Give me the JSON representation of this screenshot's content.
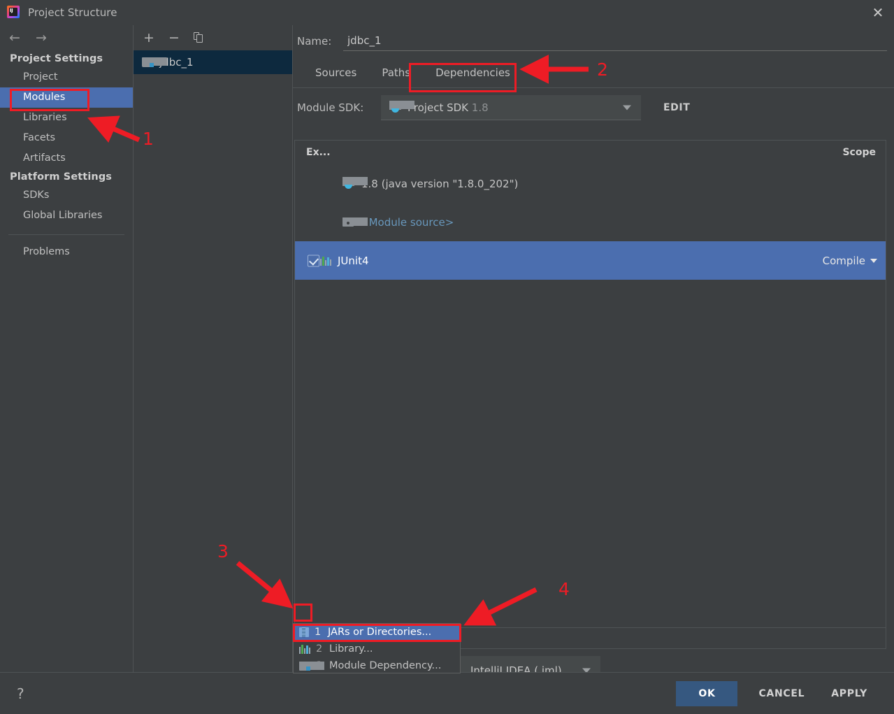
{
  "window": {
    "title": "Project Structure",
    "logo_icon": "intellij-idea-logo",
    "close_icon": "close-icon"
  },
  "sidebar": {
    "nav": {
      "back_icon": "arrow-left-icon",
      "forward_icon": "arrow-right-icon"
    },
    "groups": [
      {
        "title": "Project Settings",
        "items": [
          {
            "label": "Project",
            "selected": false
          },
          {
            "label": "Modules",
            "selected": true
          },
          {
            "label": "Libraries",
            "selected": false
          },
          {
            "label": "Facets",
            "selected": false
          },
          {
            "label": "Artifacts",
            "selected": false
          }
        ]
      },
      {
        "title": "Platform Settings",
        "items": [
          {
            "label": "SDKs",
            "selected": false
          },
          {
            "label": "Global Libraries",
            "selected": false
          }
        ]
      }
    ],
    "problems_label": "Problems"
  },
  "module_panel": {
    "toolbar": {
      "add_label": "+",
      "remove_label": "−",
      "copy_icon": "copy-icon"
    },
    "modules": [
      {
        "label": "jdbc_1",
        "icon": "module-folder-icon",
        "selected": true
      }
    ]
  },
  "main": {
    "name_label": "Name:",
    "name_value": "jdbc_1",
    "tabs": [
      {
        "label": "Sources",
        "active": false
      },
      {
        "label": "Paths",
        "active": false
      },
      {
        "label": "Dependencies",
        "active": true
      }
    ],
    "module_sdk_label": "Module SDK:",
    "module_sdk_value": "Project SDK",
    "module_sdk_version": "1.8",
    "module_sdk_icon": "java-sdk-icon",
    "edit_label": "EDIT",
    "dependencies": {
      "columns": [
        "Ex...",
        "Scope"
      ],
      "rows": [
        {
          "name": "1.8 (java version \"1.8.0_202\")",
          "icon": "java-sdk-icon",
          "scope": "",
          "checked": false,
          "selected": false,
          "link": false
        },
        {
          "name": "<Module source>",
          "icon": "module-source-icon",
          "scope": "",
          "checked": false,
          "selected": false,
          "link": true
        },
        {
          "name": "JUnit4",
          "icon": "library-icon",
          "scope": "Compile",
          "checked": true,
          "selected": true,
          "link": false
        }
      ]
    },
    "dep_toolbar": {
      "add_label": "+",
      "remove_label": "−",
      "move_up_icon": "arrow-up-icon",
      "move_down_icon": "arrow-down-icon",
      "edit_icon": "pencil-icon"
    },
    "iml_combo_value": "IntelliJ IDEA (.iml)"
  },
  "add_menu": {
    "items": [
      {
        "number": "1",
        "label": "JARs or Directories...",
        "icon": "jar-icon",
        "selected": true
      },
      {
        "number": "2",
        "label": "Library...",
        "icon": "library-icon",
        "selected": false
      },
      {
        "number": "3",
        "label": "Module Dependency...",
        "icon": "module-folder-icon",
        "selected": false
      }
    ]
  },
  "footer": {
    "help_label": "?",
    "ok_label": "OK",
    "cancel_label": "CANCEL",
    "apply_label": "APPLY"
  },
  "annotations": {
    "marker_color": "#ee1c25",
    "markers": [
      {
        "number": "1",
        "target": "sidebar-item-modules"
      },
      {
        "number": "2",
        "target": "tab-dependencies"
      },
      {
        "number": "3",
        "target": "dep-add-button"
      },
      {
        "number": "4",
        "target": "add-menu-jars-item"
      }
    ]
  },
  "colors": {
    "window_bg": "#3c3f41",
    "selection_blue": "#4b6eaf",
    "module_selection": "#0d293e",
    "primary_button": "#365880",
    "link": "#6897bb",
    "annotation_red": "#ee1c25"
  }
}
